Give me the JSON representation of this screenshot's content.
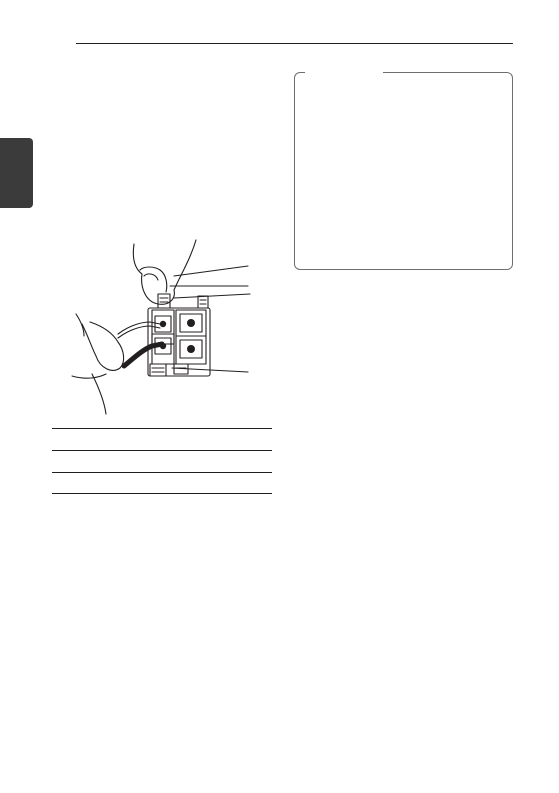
{
  "page": {
    "header_rule": "",
    "side_tab_label": ""
  },
  "note_box": {
    "title": "",
    "body": ""
  },
  "figure": {
    "icon": "speaker-terminal-connection-illustration"
  },
  "table": {
    "rows": [
      {
        "color": "",
        "speaker": ""
      },
      {
        "color": "",
        "speaker": ""
      },
      {
        "color": "",
        "speaker": ""
      }
    ]
  }
}
